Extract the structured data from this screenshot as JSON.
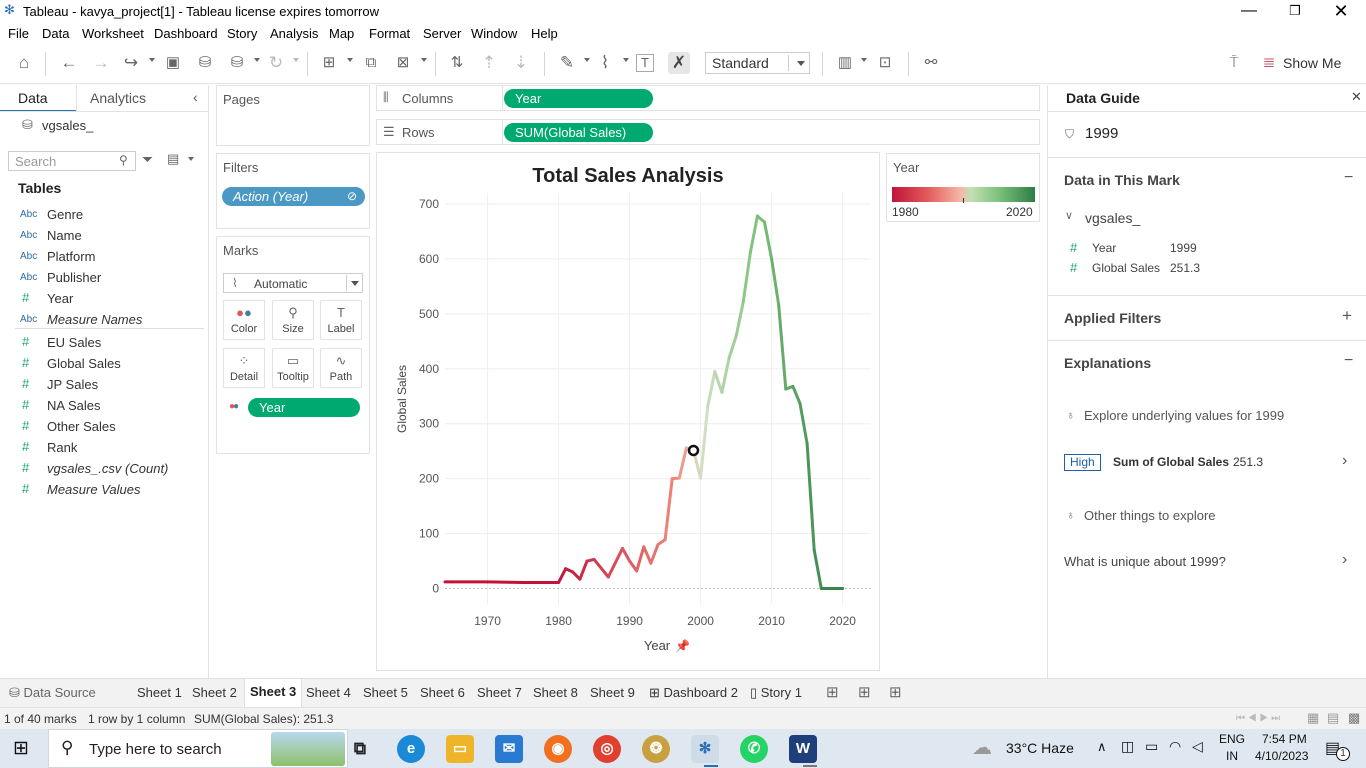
{
  "window": {
    "title": "Tableau - kavya_project[1] - Tableau license expires tomorrow"
  },
  "menu": [
    "File",
    "Data",
    "Worksheet",
    "Dashboard",
    "Story",
    "Analysis",
    "Map",
    "Format",
    "Server",
    "Window",
    "Help"
  ],
  "toolbar": {
    "fit_value": "Standard",
    "show_me_label": "Show Me"
  },
  "data_pane": {
    "tab_data": "Data",
    "tab_analytics": "Analytics",
    "datasource": "vgsales_",
    "search_placeholder": "Search",
    "tables_heading": "Tables",
    "fields": [
      {
        "type": "Abc",
        "name": "Genre"
      },
      {
        "type": "Abc",
        "name": "Name"
      },
      {
        "type": "Abc",
        "name": "Platform"
      },
      {
        "type": "Abc",
        "name": "Publisher"
      },
      {
        "type": "#",
        "name": "Year"
      },
      {
        "type": "Abc",
        "name": "Measure Names"
      },
      {
        "type": "#",
        "name": "EU Sales"
      },
      {
        "type": "#",
        "name": "Global Sales"
      },
      {
        "type": "#",
        "name": "JP Sales"
      },
      {
        "type": "#",
        "name": "NA Sales"
      },
      {
        "type": "#",
        "name": "Other Sales"
      },
      {
        "type": "#",
        "name": "Rank"
      },
      {
        "type": "#",
        "name": "vgsales_.csv (Count)"
      },
      {
        "type": "#",
        "name": "Measure Values"
      }
    ]
  },
  "shelves": {
    "pages_label": "Pages",
    "filters_label": "Filters",
    "filter_pill": "Action (Year)",
    "marks_label": "Marks",
    "mark_type": "Automatic",
    "mark_buttons": [
      "Color",
      "Size",
      "Label",
      "Detail",
      "Tooltip",
      "Path"
    ],
    "marks_pill": "Year",
    "columns_label": "Columns",
    "columns_pill": "Year",
    "rows_label": "Rows",
    "rows_pill": "SUM(Global Sales)"
  },
  "legend": {
    "title": "Year",
    "min_label": "1980",
    "max_label": "2020"
  },
  "chart_data": {
    "type": "line",
    "title": "Total Sales Analysis",
    "xlabel": "Year",
    "ylabel": "Global Sales",
    "xlim": [
      1964,
      2024
    ],
    "ylim": [
      -30,
      720
    ],
    "x_ticks": [
      "1970",
      "1980",
      "1990",
      "2000",
      "2010",
      "2020"
    ],
    "y_ticks": [
      "0",
      "100",
      "200",
      "300",
      "400",
      "500",
      "600",
      "700"
    ],
    "grid": true,
    "legend_position": "top-right",
    "series": [
      {
        "x": [
          1962,
          1965,
          1970,
          1975,
          1980,
          1981,
          1982,
          1983,
          1984,
          1985,
          1986,
          1987,
          1988,
          1989,
          1990,
          1991,
          1992,
          1993,
          1994,
          1995,
          1996,
          1997,
          1998,
          1999,
          2000,
          2001,
          2002,
          2003,
          2004,
          2005,
          2006,
          2007,
          2008,
          2009,
          2010,
          2011,
          2012,
          2013,
          2014,
          2015,
          2016,
          2017,
          2020
        ],
        "values": [
          12,
          12,
          12,
          11,
          11,
          36,
          30,
          17,
          50,
          53,
          37,
          21,
          47,
          73,
          50,
          32,
          76,
          46,
          80,
          89,
          200,
          201,
          256,
          251.3,
          201,
          331,
          395,
          357,
          419,
          459,
          521,
          611,
          678,
          667,
          600,
          516,
          363,
          368,
          337,
          264,
          70,
          0,
          0
        ]
      }
    ],
    "selected_point": {
      "x": 1999,
      "y": 251.3
    },
    "color_range": [
      "#c0143c",
      "#f08a7a",
      "#d8e0c8",
      "#7cc07a",
      "#2e7d46"
    ]
  },
  "data_guide": {
    "title": "Data Guide",
    "mark_name": "1999",
    "section_data": "Data in This Mark",
    "source": "vgsales_",
    "rows": [
      {
        "field": "Year",
        "value": "1999"
      },
      {
        "field": "Global Sales",
        "value": "251.3"
      }
    ],
    "section_filters": "Applied Filters",
    "section_explanations": "Explanations",
    "explore_text": "Explore underlying values for 1999",
    "badge": "High",
    "sum_label": "Sum of Global Sales",
    "sum_value": "251.3",
    "other_text": "Other things to explore",
    "unique_text": "What is unique about 1999?"
  },
  "sheet_tabs": [
    "Data Source",
    "Sheet 1",
    "Sheet 2",
    "Sheet 3",
    "Sheet 4",
    "Sheet 5",
    "Sheet 6",
    "Sheet 7",
    "Sheet 8",
    "Sheet 9",
    "Dashboard 2",
    "Story 1"
  ],
  "status": {
    "marks": "1 of 40 marks",
    "dims": "1 row by 1 column",
    "sum": "SUM(Global Sales): 251.3"
  },
  "taskbar": {
    "search_placeholder": "Type here to search",
    "weather": "33°C  Haze",
    "lang1": "ENG",
    "lang2": "IN",
    "time": "7:54 PM",
    "date": "4/10/2023",
    "notif_count": "1"
  }
}
